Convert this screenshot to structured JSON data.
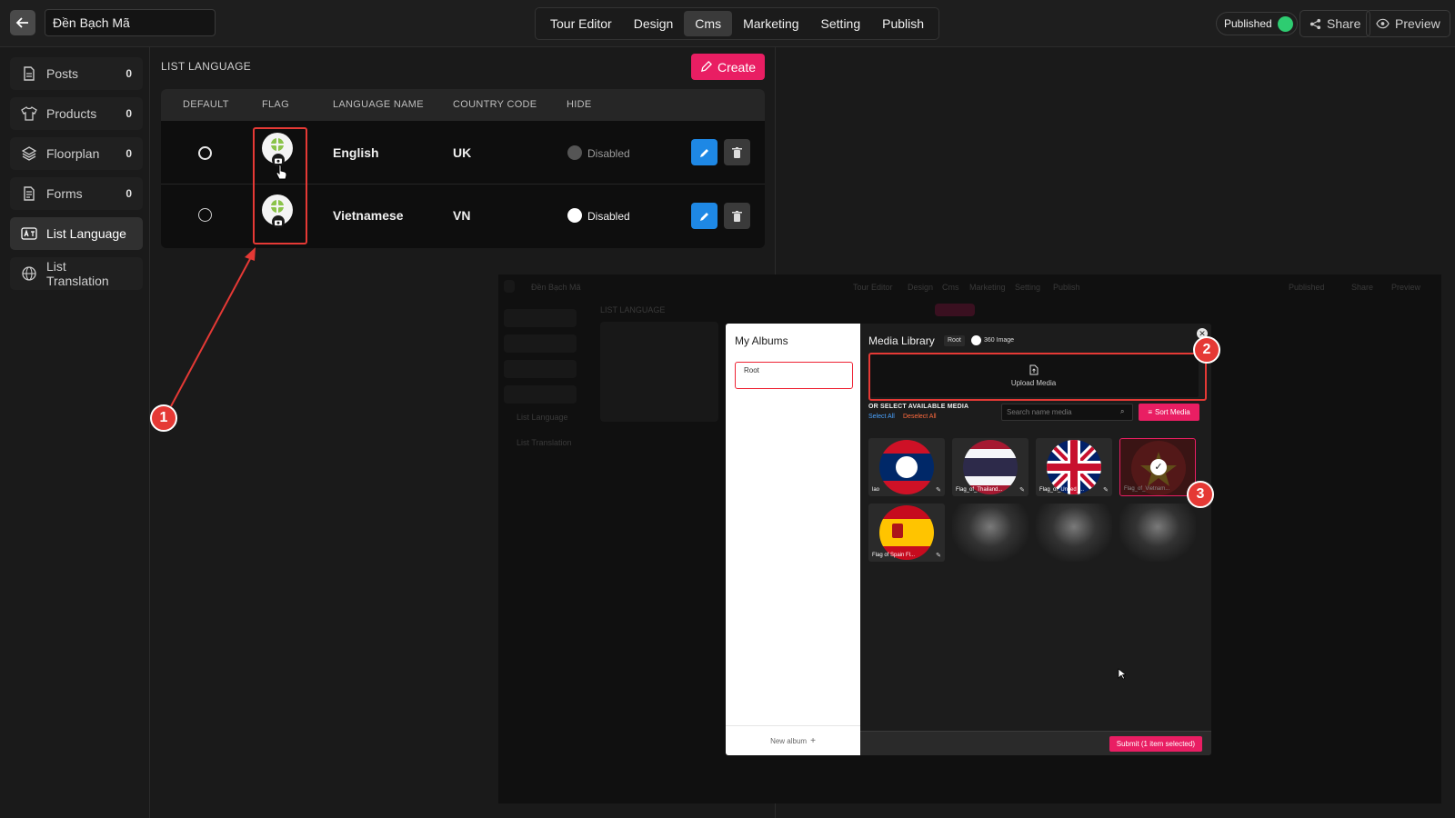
{
  "header": {
    "title_value": "Đền Bạch Mã",
    "nav_tabs": [
      "Tour Editor",
      "Design",
      "Cms",
      "Marketing",
      "Setting",
      "Publish"
    ],
    "active_tab": "Cms",
    "published_label": "Published",
    "share_label": "Share",
    "preview_label": "Preview"
  },
  "sidebar": {
    "items": [
      {
        "label": "Posts",
        "count": "0",
        "icon": "document-icon"
      },
      {
        "label": "Products",
        "count": "0",
        "icon": "shirt-icon"
      },
      {
        "label": "Floorplan",
        "count": "0",
        "icon": "layers-icon"
      },
      {
        "label": "Forms",
        "count": "0",
        "icon": "form-icon"
      },
      {
        "label": "List Language",
        "count": "",
        "icon": "language-icon"
      },
      {
        "label": "List Translation",
        "count": "",
        "icon": "globe-icon"
      }
    ]
  },
  "main": {
    "section_title": "LIST LANGUAGE",
    "create_label": "Create",
    "columns": [
      "DEFAULT",
      "FLAG",
      "LANGUAGE NAME",
      "COUNTRY CODE",
      "HIDE"
    ],
    "rows": [
      {
        "name": "English",
        "code": "UK",
        "hide": "Disabled",
        "toggle_on": false
      },
      {
        "name": "Vietnamese",
        "code": "VN",
        "hide": "Disabled",
        "toggle_on": true
      }
    ]
  },
  "annotations": [
    "1",
    "2",
    "3"
  ],
  "modal": {
    "albums_title": "My Albums",
    "album_root": "Root",
    "new_album": "New album",
    "library_title": "Media Library",
    "root_chip": "Root",
    "image_360": "360 Image",
    "upload_label": "Upload Media",
    "or_select": "OR SELECT AVAILABLE MEDIA",
    "select_all": "Select All",
    "deselect_all": "Deselect All",
    "search_placeholder": "Search name media",
    "sort_label": "Sort Media",
    "thumbs": [
      "lao",
      "Flag_of_Thailand...",
      "Flag_of_United_...",
      "Flag_of_Vietnam...",
      "Flag of Spain Fl..."
    ],
    "submit_label": "Submit (1 item selected)"
  },
  "colors": {
    "accent": "#e91e63",
    "edit": "#1e88e5",
    "published": "#2ecc71",
    "annotation": "#e53935"
  }
}
